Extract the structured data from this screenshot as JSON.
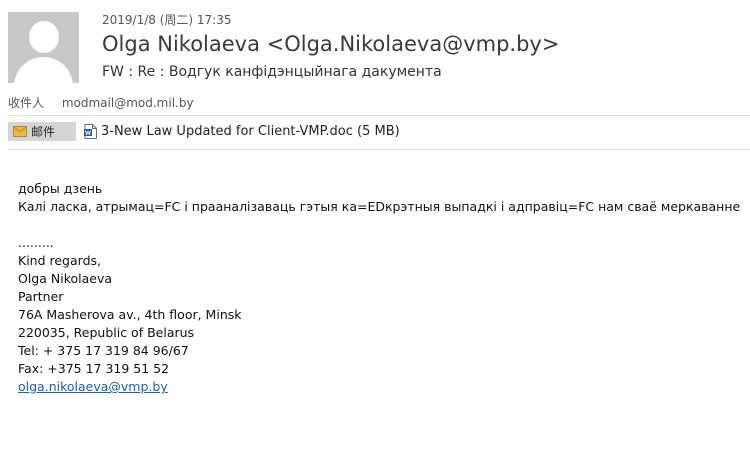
{
  "header": {
    "avatar_icon": "person-avatar-icon",
    "date": "2019/1/8 (周二) 17:35",
    "sender": "Olga Nikolaeva <Olga.Nikolaeva@vmp.by>",
    "subject": "FW : Re : Водгук канфідэнцыйнага дакумента"
  },
  "recipient": {
    "label": "收件人",
    "address": "modmail@mod.mil.by"
  },
  "attachments_bar": {
    "mail_label": "邮件",
    "mail_icon": "envelope-icon",
    "file_icon": "word-document-icon",
    "file_name": "3-New Law Updated for Client-VMP.doc (5 MB)"
  },
  "body": {
    "greeting": "добры дзень",
    "request": "Калі ласка, атрымац=FC і прааналізаваць гэтыя ка=EDкрэтныя выпадкі і адправіц=FC нам сваё меркаванне",
    "dots": ".........",
    "closing": "Kind regards,",
    "name": "Olga Nikolaeva",
    "title": "Partner",
    "address1": "76A Masherova av., 4th floor, Minsk",
    "address2": "220035, Republic of Belarus",
    "tel": "Tel:  + 375 17 319 84 96/67",
    "fax": "Fax: +375 17 319 51 52",
    "email": "olga.nikolaeva@vmp.by"
  },
  "colors": {
    "link": "#1b5fb5",
    "badge_bg": "#d4d4d4",
    "avatar_bg": "#c8c8c8"
  }
}
